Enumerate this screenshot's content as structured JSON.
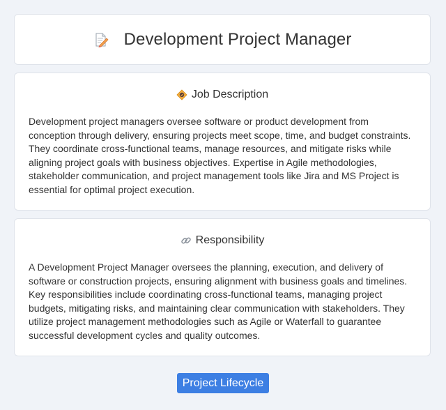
{
  "header": {
    "icon": "memo-pencil-icon",
    "title": "Development Project Manager"
  },
  "job_description": {
    "icon": "diamond-badge-icon",
    "heading": "Job Description",
    "text": "Development project managers oversee software or product development from conception through delivery, ensuring projects meet scope, time, and budget constraints. They coordinate cross-functional teams, manage resources, and mitigate risks while aligning project goals with business objectives. Expertise in Agile methodologies, stakeholder communication, and project management tools like Jira and MS Project is essential for optimal project execution."
  },
  "responsibility": {
    "icon": "link-icon",
    "heading": "Responsibility",
    "text": "A Development Project Manager oversees the planning, execution, and delivery of software or construction projects, ensuring alignment with business goals and timelines. Key responsibilities include coordinating cross-functional teams, managing project budgets, mitigating risks, and maintaining clear communication with stakeholders. They utilize project management methodologies such as Agile or Waterfall to guarantee successful development cycles and quality outcomes."
  },
  "footer": {
    "button_label": "Project Lifecycle"
  },
  "colors": {
    "background": "#f0f3f8",
    "card": "#ffffff",
    "accent": "#3d7fe3",
    "text": "#333333"
  }
}
